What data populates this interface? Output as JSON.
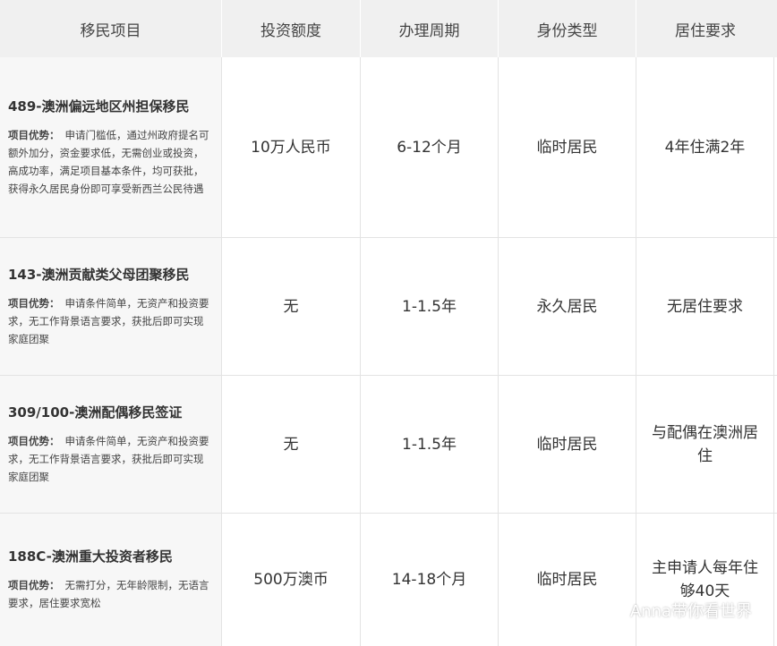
{
  "headers": [
    "移民项目",
    "投资额度",
    "办理周期",
    "身份类型",
    "居住要求"
  ],
  "rows": [
    {
      "title": "489-澳洲偏远地区州担保移民",
      "label": "项目优势：",
      "desc": "申请门槛低，通过州政府提名可额外加分，资金要求低，无需创业或投资，高成功率，满足项目基本条件，均可获批，获得永久居民身份即可享受新西兰公民待遇",
      "investment": "10万人民币",
      "period": "6-12个月",
      "status": "临时居民",
      "residency": "4年住满2年"
    },
    {
      "title": "143-澳洲贡献类父母团聚移民",
      "label": "项目优势：",
      "desc": "申请条件简单，无资产和投资要求，无工作背景语言要求，获批后即可实现家庭团聚",
      "investment": "无",
      "period": "1-1.5年",
      "status": "永久居民",
      "residency": "无居住要求"
    },
    {
      "title": "309/100-澳洲配偶移民签证",
      "label": "项目优势：",
      "desc": "申请条件简单，无资产和投资要求，无工作背景语言要求，获批后即可实现家庭团聚",
      "investment": "无",
      "period": "1-1.5年",
      "status": "临时居民",
      "residency": "与配偶在澳洲居住"
    },
    {
      "title": "188C-澳洲重大投资者移民",
      "label": "项目优势：",
      "desc": "无需打分，无年龄限制，无语言要求，居住要求宽松",
      "investment": "500万澳币",
      "period": "14-18个月",
      "status": "临时居民",
      "residency": "主申请人每年住够40天"
    }
  ],
  "watermark": {
    "icon": "wechat-icon",
    "text": "Anna带你看世界"
  }
}
